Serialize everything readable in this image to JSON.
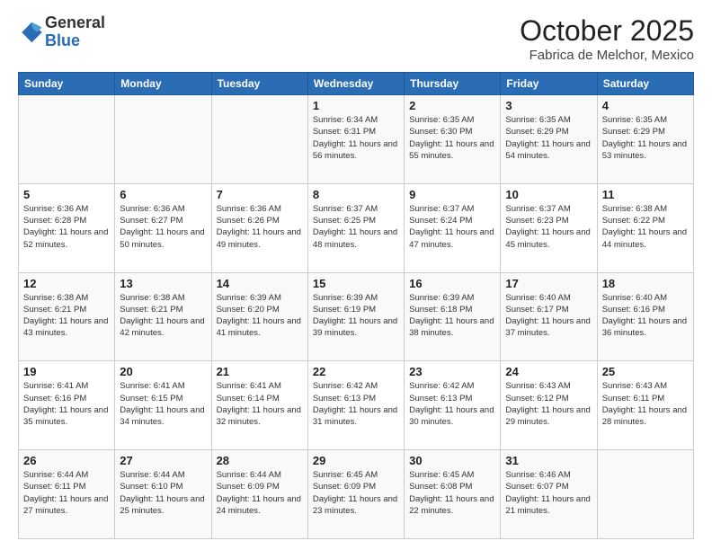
{
  "header": {
    "logo_general": "General",
    "logo_blue": "Blue",
    "month_title": "October 2025",
    "subtitle": "Fabrica de Melchor, Mexico"
  },
  "days_of_week": [
    "Sunday",
    "Monday",
    "Tuesday",
    "Wednesday",
    "Thursday",
    "Friday",
    "Saturday"
  ],
  "weeks": [
    [
      {
        "day": "",
        "info": ""
      },
      {
        "day": "",
        "info": ""
      },
      {
        "day": "",
        "info": ""
      },
      {
        "day": "1",
        "info": "Sunrise: 6:34 AM\nSunset: 6:31 PM\nDaylight: 11 hours and 56 minutes."
      },
      {
        "day": "2",
        "info": "Sunrise: 6:35 AM\nSunset: 6:30 PM\nDaylight: 11 hours and 55 minutes."
      },
      {
        "day": "3",
        "info": "Sunrise: 6:35 AM\nSunset: 6:29 PM\nDaylight: 11 hours and 54 minutes."
      },
      {
        "day": "4",
        "info": "Sunrise: 6:35 AM\nSunset: 6:29 PM\nDaylight: 11 hours and 53 minutes."
      }
    ],
    [
      {
        "day": "5",
        "info": "Sunrise: 6:36 AM\nSunset: 6:28 PM\nDaylight: 11 hours and 52 minutes."
      },
      {
        "day": "6",
        "info": "Sunrise: 6:36 AM\nSunset: 6:27 PM\nDaylight: 11 hours and 50 minutes."
      },
      {
        "day": "7",
        "info": "Sunrise: 6:36 AM\nSunset: 6:26 PM\nDaylight: 11 hours and 49 minutes."
      },
      {
        "day": "8",
        "info": "Sunrise: 6:37 AM\nSunset: 6:25 PM\nDaylight: 11 hours and 48 minutes."
      },
      {
        "day": "9",
        "info": "Sunrise: 6:37 AM\nSunset: 6:24 PM\nDaylight: 11 hours and 47 minutes."
      },
      {
        "day": "10",
        "info": "Sunrise: 6:37 AM\nSunset: 6:23 PM\nDaylight: 11 hours and 45 minutes."
      },
      {
        "day": "11",
        "info": "Sunrise: 6:38 AM\nSunset: 6:22 PM\nDaylight: 11 hours and 44 minutes."
      }
    ],
    [
      {
        "day": "12",
        "info": "Sunrise: 6:38 AM\nSunset: 6:21 PM\nDaylight: 11 hours and 43 minutes."
      },
      {
        "day": "13",
        "info": "Sunrise: 6:38 AM\nSunset: 6:21 PM\nDaylight: 11 hours and 42 minutes."
      },
      {
        "day": "14",
        "info": "Sunrise: 6:39 AM\nSunset: 6:20 PM\nDaylight: 11 hours and 41 minutes."
      },
      {
        "day": "15",
        "info": "Sunrise: 6:39 AM\nSunset: 6:19 PM\nDaylight: 11 hours and 39 minutes."
      },
      {
        "day": "16",
        "info": "Sunrise: 6:39 AM\nSunset: 6:18 PM\nDaylight: 11 hours and 38 minutes."
      },
      {
        "day": "17",
        "info": "Sunrise: 6:40 AM\nSunset: 6:17 PM\nDaylight: 11 hours and 37 minutes."
      },
      {
        "day": "18",
        "info": "Sunrise: 6:40 AM\nSunset: 6:16 PM\nDaylight: 11 hours and 36 minutes."
      }
    ],
    [
      {
        "day": "19",
        "info": "Sunrise: 6:41 AM\nSunset: 6:16 PM\nDaylight: 11 hours and 35 minutes."
      },
      {
        "day": "20",
        "info": "Sunrise: 6:41 AM\nSunset: 6:15 PM\nDaylight: 11 hours and 34 minutes."
      },
      {
        "day": "21",
        "info": "Sunrise: 6:41 AM\nSunset: 6:14 PM\nDaylight: 11 hours and 32 minutes."
      },
      {
        "day": "22",
        "info": "Sunrise: 6:42 AM\nSunset: 6:13 PM\nDaylight: 11 hours and 31 minutes."
      },
      {
        "day": "23",
        "info": "Sunrise: 6:42 AM\nSunset: 6:13 PM\nDaylight: 11 hours and 30 minutes."
      },
      {
        "day": "24",
        "info": "Sunrise: 6:43 AM\nSunset: 6:12 PM\nDaylight: 11 hours and 29 minutes."
      },
      {
        "day": "25",
        "info": "Sunrise: 6:43 AM\nSunset: 6:11 PM\nDaylight: 11 hours and 28 minutes."
      }
    ],
    [
      {
        "day": "26",
        "info": "Sunrise: 6:44 AM\nSunset: 6:11 PM\nDaylight: 11 hours and 27 minutes."
      },
      {
        "day": "27",
        "info": "Sunrise: 6:44 AM\nSunset: 6:10 PM\nDaylight: 11 hours and 25 minutes."
      },
      {
        "day": "28",
        "info": "Sunrise: 6:44 AM\nSunset: 6:09 PM\nDaylight: 11 hours and 24 minutes."
      },
      {
        "day": "29",
        "info": "Sunrise: 6:45 AM\nSunset: 6:09 PM\nDaylight: 11 hours and 23 minutes."
      },
      {
        "day": "30",
        "info": "Sunrise: 6:45 AM\nSunset: 6:08 PM\nDaylight: 11 hours and 22 minutes."
      },
      {
        "day": "31",
        "info": "Sunrise: 6:46 AM\nSunset: 6:07 PM\nDaylight: 11 hours and 21 minutes."
      },
      {
        "day": "",
        "info": ""
      }
    ]
  ]
}
